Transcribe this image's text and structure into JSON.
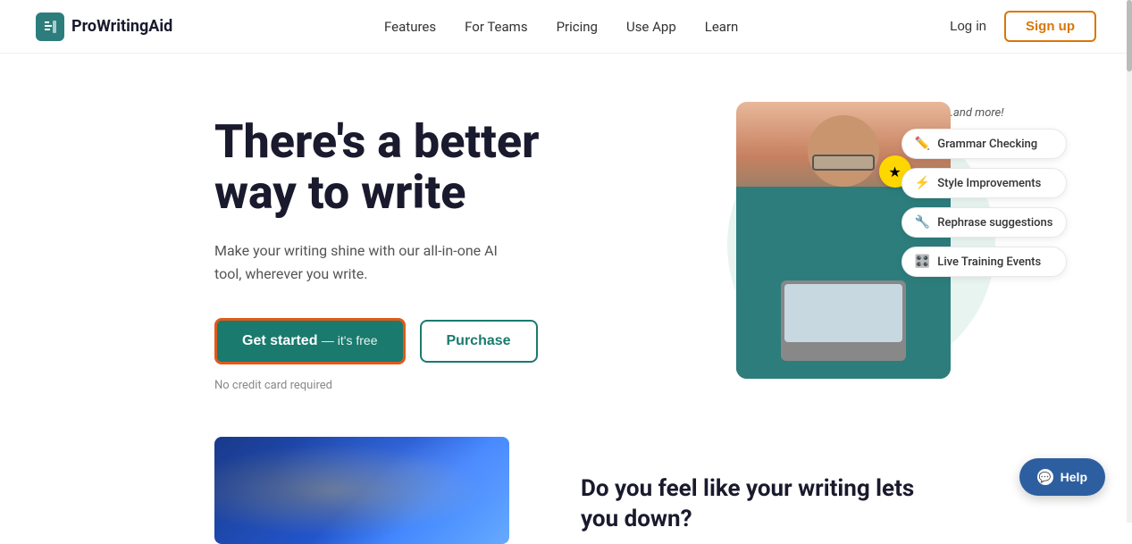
{
  "navbar": {
    "logo_text": "ProWritingAid",
    "nav_items": [
      {
        "id": "features",
        "label": "Features"
      },
      {
        "id": "teams",
        "label": "For Teams"
      },
      {
        "id": "pricing",
        "label": "Pricing"
      },
      {
        "id": "use-app",
        "label": "Use App"
      },
      {
        "id": "learn",
        "label": "Learn"
      }
    ],
    "login_label": "Log in",
    "signup_label": "Sign up"
  },
  "hero": {
    "title_line1": "There's a better",
    "title_line2": "way to write",
    "subtitle": "Make your writing shine with our all-in-one AI tool, wherever you write.",
    "cta_label": "Get started",
    "cta_free": "— it's free",
    "purchase_label": "Purchase",
    "no_credit_label": "No credit card required",
    "more_label": "...and more!",
    "feature_pills": [
      {
        "id": "grammar",
        "icon": "✏️",
        "label": "Grammar Checking"
      },
      {
        "id": "style",
        "icon": "⚡",
        "label": "Style Improvements"
      },
      {
        "id": "rephrase",
        "icon": "🔧",
        "label": "Rephrase suggestions"
      },
      {
        "id": "training",
        "icon": "🎛️",
        "label": "Live Training Events"
      }
    ],
    "star_icon": "★"
  },
  "bottom": {
    "tagline": "Do you feel like your writing lets you down?"
  },
  "help": {
    "label": "Help",
    "icon": "💬"
  }
}
